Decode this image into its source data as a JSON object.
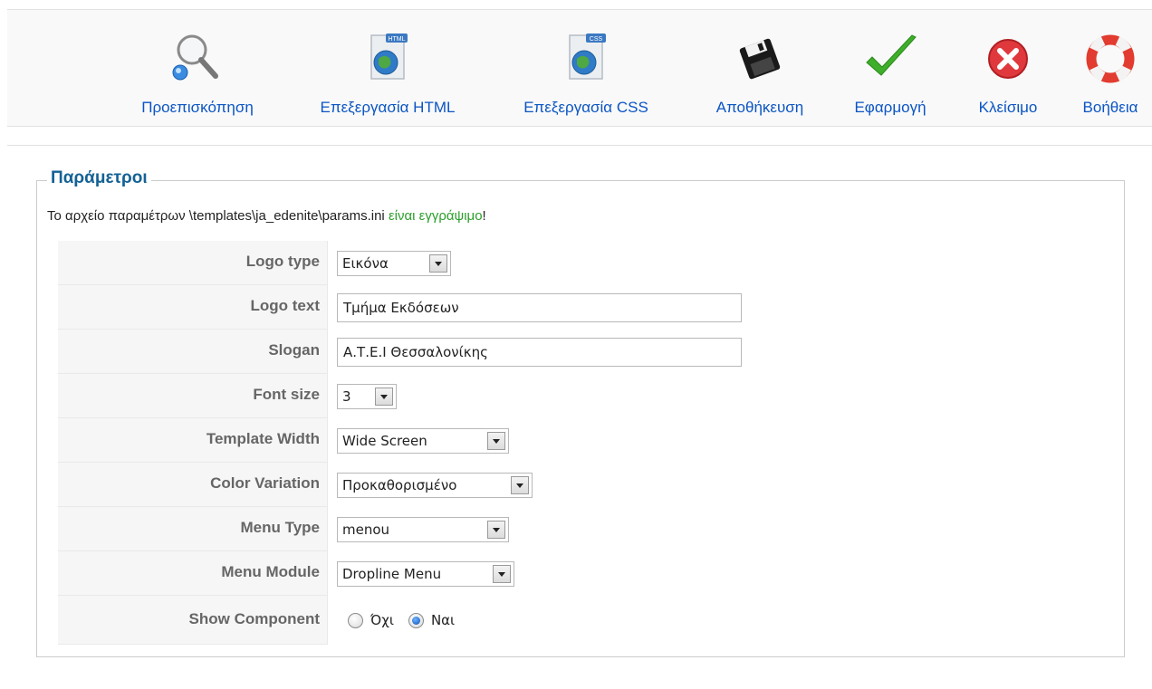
{
  "toolbar": {
    "preview": "Προεπισκόπηση",
    "edit_html": "Επεξεργασία HTML",
    "edit_css": "Επεξεργασία CSS",
    "save": "Αποθήκευση",
    "apply": "Εφαρμογή",
    "close": "Κλείσιμο",
    "help": "Βοήθεια",
    "html_badge": "HTML",
    "css_badge": "CSS"
  },
  "params": {
    "legend": "Παράμετροι",
    "note_prefix": "Το αρχείο παραμέτρων \\templates\\ja_edenite\\params.ini",
    "note_status": "είναι εγγράψιμο",
    "note_suffix": "!",
    "logo_type": {
      "label": "Logo type",
      "value": "Εικόνα"
    },
    "logo_text": {
      "label": "Logo text",
      "value": "Τμήμα Εκδόσεων"
    },
    "slogan": {
      "label": "Slogan",
      "value": "Α.Τ.Ε.Ι Θεσσαλονίκης"
    },
    "font_size": {
      "label": "Font size",
      "value": "3"
    },
    "template_width": {
      "label": "Template Width",
      "value": "Wide Screen"
    },
    "color_variation": {
      "label": "Color Variation",
      "value": "Προκαθορισμένο"
    },
    "menu_type": {
      "label": "Menu Type",
      "value": "menou"
    },
    "menu_module": {
      "label": "Menu Module",
      "value": "Dropline Menu"
    },
    "show_component": {
      "label": "Show Component",
      "no": "Όχι",
      "yes": "Ναι",
      "selected": "yes"
    }
  },
  "colors": {
    "link_blue": "#0b55c4",
    "legend_blue": "#146295",
    "ok_green": "#2a9f2a"
  }
}
